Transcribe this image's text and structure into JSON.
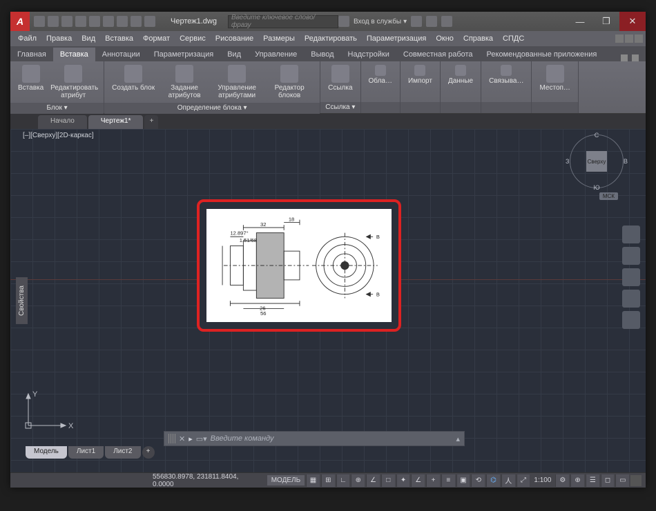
{
  "titlebar": {
    "app_logo_letter": "A",
    "document_title": "Чертеж1.dwg",
    "search_placeholder": "Введите ключевое слово/фразу",
    "signin_label": "Вход в службы"
  },
  "window_controls": {
    "min": "—",
    "max": "❐",
    "close": "✕"
  },
  "menu": [
    "Файл",
    "Правка",
    "Вид",
    "Вставка",
    "Формат",
    "Сервис",
    "Рисование",
    "Размеры",
    "Редактировать",
    "Параметризация",
    "Окно",
    "Справка",
    "СПДС"
  ],
  "ribbon_tabs": {
    "items": [
      "Главная",
      "Вставка",
      "Аннотации",
      "Параметризация",
      "Вид",
      "Управление",
      "Вывод",
      "Надстройки",
      "Совместная работа",
      "Рекомендованные приложения"
    ],
    "active_index": 1
  },
  "ribbon": {
    "panel_block": {
      "title": "Блок ▾",
      "insert": "Вставка",
      "edit_attr": "Редактировать атрибут"
    },
    "panel_blockdef": {
      "title": "Определение блока ▾",
      "create": "Создать блок",
      "set_attr": "Задание атрибутов",
      "manage_attr": "Управление атрибутами",
      "block_editor": "Редактор блоков"
    },
    "panel_ref": {
      "title": "Ссылка ▾",
      "ref": "Ссылка"
    },
    "panel_data": {
      "cloud": "Обла…",
      "import": "Импорт",
      "data": "Данные",
      "link": "Связыва…"
    },
    "panel_loc": {
      "loc": "Местоп…"
    }
  },
  "doctabs": {
    "start": "Начало",
    "doc": "Чертеж1*",
    "plus": "+"
  },
  "canvas": {
    "view_label": "[–][Сверху][2D-каркас]",
    "props_label": "Свойства",
    "viewcube": {
      "face": "Сверху",
      "n": "С",
      "s": "Ю",
      "w": "З",
      "e": "В",
      "msk": "МСК"
    },
    "ucs": {
      "x": "X",
      "y": "Y"
    }
  },
  "cmdline": {
    "prompt": "▸",
    "placeholder": "Введите команду"
  },
  "layout_tabs": {
    "model": "Модель",
    "sheet1": "Лист1",
    "sheet2": "Лист2",
    "plus": "+"
  },
  "statusbar": {
    "coords": "556830.8978, 231811.8404, 0.0000",
    "model": "МОДЕЛЬ",
    "scale": "1:100"
  }
}
